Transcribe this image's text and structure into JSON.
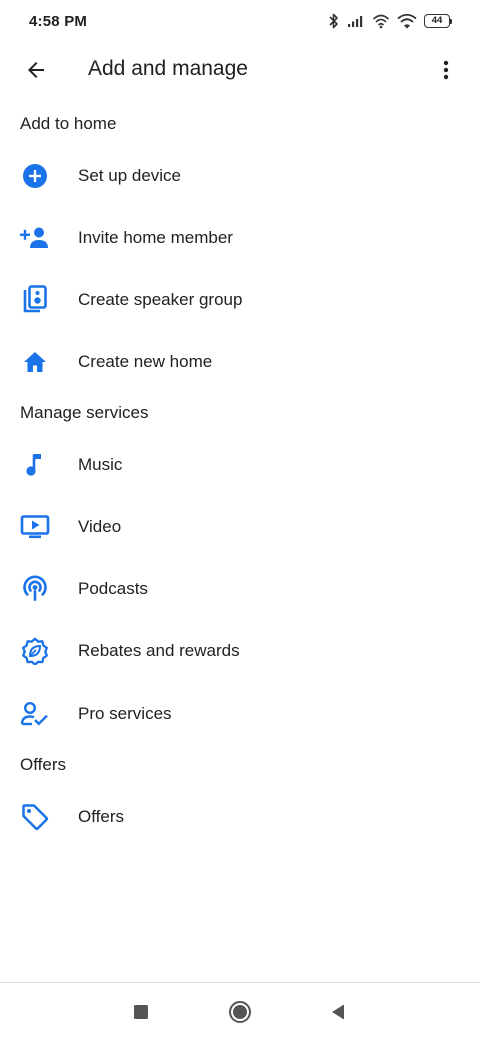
{
  "status_bar": {
    "time": "4:58 PM",
    "battery": "44",
    "icons": [
      "bluetooth-icon",
      "signal-icon",
      "hotspot-icon",
      "wifi-icon",
      "battery-icon"
    ]
  },
  "app_bar": {
    "title": "Add and manage",
    "back_icon": "arrow-back-icon",
    "more_icon": "more-vert-icon"
  },
  "accent_color": "#1a73e8",
  "sections": [
    {
      "header": "Add to home",
      "items": [
        {
          "label": "Set up device",
          "icon": "add-circle-icon"
        },
        {
          "label": "Invite home member",
          "icon": "person-add-icon"
        },
        {
          "label": "Create speaker group",
          "icon": "speaker-group-icon"
        },
        {
          "label": "Create new home",
          "icon": "home-icon"
        }
      ]
    },
    {
      "header": "Manage services",
      "items": [
        {
          "label": "Music",
          "icon": "music-note-icon"
        },
        {
          "label": "Video",
          "icon": "video-icon"
        },
        {
          "label": "Podcasts",
          "icon": "podcast-icon"
        },
        {
          "label": "Rebates and rewards",
          "icon": "rewards-leaf-icon"
        },
        {
          "label": "Pro services",
          "icon": "pro-services-icon"
        }
      ]
    },
    {
      "header": "Offers",
      "items": [
        {
          "label": "Offers",
          "icon": "tag-icon"
        }
      ]
    }
  ],
  "nav_bar": {
    "buttons": [
      "recents-square-icon",
      "home-circle-icon",
      "back-triangle-icon"
    ]
  }
}
